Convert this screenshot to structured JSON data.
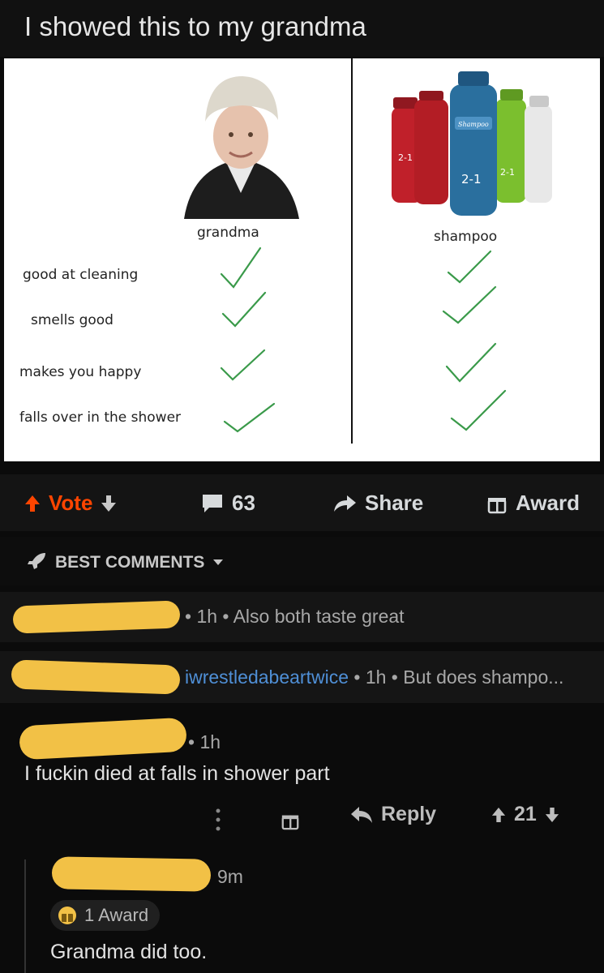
{
  "post": {
    "title": "I showed this to my grandma"
  },
  "meme": {
    "col_grandma": "grandma",
    "col_shampoo": "shampoo",
    "rows": [
      "good at cleaning",
      "smells good",
      "makes you happy",
      "falls over in the shower"
    ],
    "bottle_labels": [
      "2-1",
      "2-1",
      "2-1",
      "Shampoo"
    ]
  },
  "actions": {
    "vote": "Vote",
    "comments": "63",
    "share": "Share",
    "award": "Award"
  },
  "section": {
    "label": "BEST COMMENTS"
  },
  "comments": [
    {
      "meta": "• 1h • Also both taste great"
    },
    {
      "username": "iwrestledabeartwice",
      "meta": " • 1h • But does shampo..."
    },
    {
      "meta": "• 1h",
      "body": "I fuckin died at falls in shower part",
      "reply": "Reply",
      "score": "21"
    },
    {
      "meta": "9m",
      "award": "1 Award",
      "body": "Grandma did too."
    }
  ],
  "colors": {
    "accent": "#ff4500",
    "censor": "#f2c146",
    "check": "#3a9a4a"
  }
}
